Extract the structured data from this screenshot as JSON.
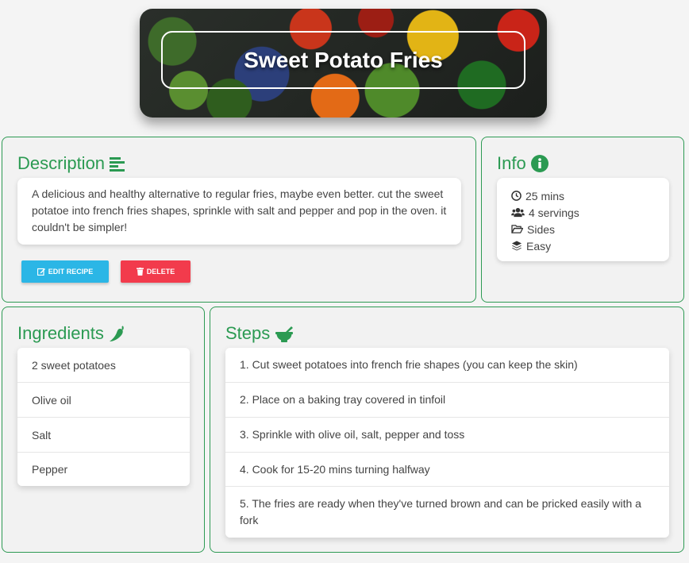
{
  "header": {
    "title": "Sweet Potato Fries"
  },
  "description": {
    "title": "Description",
    "text": "A delicious and healthy alternative to regular fries, maybe even better. cut the sweet potatoe into french fries shapes, sprinkle with salt and pepper and pop in the oven. it couldn't be simpler!",
    "edit_label": "EDIT RECIPE",
    "delete_label": "DELETE"
  },
  "info": {
    "title": "Info",
    "time": "25 mins",
    "servings": "4 servings",
    "category": "Sides",
    "difficulty": "Easy"
  },
  "ingredients": {
    "title": "Ingredients",
    "items": [
      "2 sweet potatoes",
      "Olive oil",
      "Salt",
      "Pepper"
    ]
  },
  "steps": {
    "title": "Steps",
    "items": [
      "1. Cut sweet potatoes into french frie shapes (you can keep the skin)",
      "2. Place on a baking tray covered in tinfoil",
      "3. Sprinkle with olive oil, salt, pepper and toss",
      "4. Cook for 15-20 mins turning halfway",
      "5. The fries are ready when they've turned brown and can be pricked easily with a fork"
    ]
  },
  "colors": {
    "accent": "#2b9a52",
    "edit_button": "#2bb6e6",
    "delete_button": "#f23b4c"
  },
  "icons": {
    "description": "align-left-icon",
    "info": "info-circle-icon",
    "time": "clock-icon",
    "servings": "users-icon",
    "category": "folder-open-icon",
    "difficulty": "layers-icon",
    "ingredients": "chili-pepper-icon",
    "steps": "mortar-pestle-icon",
    "edit": "edit-icon",
    "delete": "trash-icon"
  }
}
